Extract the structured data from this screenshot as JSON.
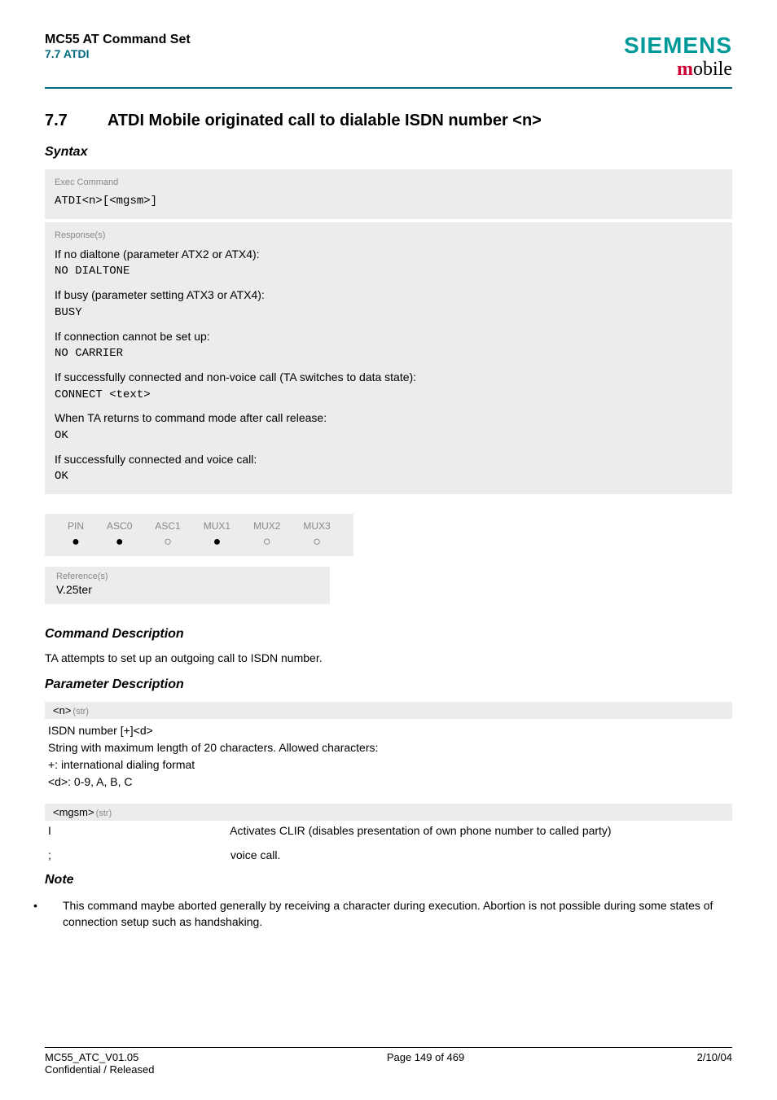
{
  "header": {
    "title": "MC55 AT Command Set",
    "subtitle": "7.7 ATDI",
    "logo_main": "SIEMENS",
    "logo_sub_m": "m",
    "logo_sub_rest": "obile"
  },
  "section": {
    "number": "7.7",
    "title": "ATDI   Mobile originated call to dialable ISDN number <n>"
  },
  "syntax": {
    "heading": "Syntax",
    "exec_label": "Exec Command",
    "exec_cmd_prefix": "ATDI",
    "exec_cmd_param": "<n>",
    "exec_cmd_open": "[",
    "exec_cmd_mgsm": "<mgsm>",
    "exec_cmd_close": "]",
    "resp_label": "Response(s)",
    "lines": [
      {
        "pre": "If no dialtone (parameter ATX2 or ATX4):",
        "code": "NO DIALTONE"
      },
      {
        "pre": "If busy (parameter setting ATX3 or ATX4):",
        "code": "BUSY"
      },
      {
        "pre": "If connection cannot be set up:",
        "code": "NO CARRIER"
      },
      {
        "pre": "If successfully connected and non-voice call (TA switches to data state):",
        "code": "CONNECT <text>"
      },
      {
        "pre": "When TA returns to command mode after call release:",
        "code": "OK"
      },
      {
        "pre": "If successfully connected and voice call:",
        "code": "OK"
      }
    ]
  },
  "indicators": {
    "cols": [
      "PIN",
      "ASC0",
      "ASC1",
      "MUX1",
      "MUX2",
      "MUX3"
    ],
    "vals": [
      "filled",
      "filled",
      "empty",
      "filled",
      "empty",
      "empty"
    ]
  },
  "reference": {
    "label": "Reference(s)",
    "text": "V.25ter"
  },
  "cmd_desc": {
    "heading": "Command Description",
    "text": "TA attempts to set up an outgoing call to ISDN number."
  },
  "param_desc": {
    "heading": "Parameter Description",
    "p1_name": "<n>",
    "p1_type": "(str)",
    "p1_lines": "ISDN number [+]<d>\nString with maximum length of 20 characters. Allowed characters:\n+: international dialing format\n<d>:  0-9, A, B, C",
    "p2_name": "<mgsm>",
    "p2_type": "(str)",
    "p2_line1": "I",
    "p2_desc1": "Activates CLIR (disables presentation of own phone number to called party)",
    "p2_line2": ";",
    "p2_desc2": "voice call."
  },
  "note": {
    "heading": "Note",
    "item": "This command maybe aborted generally by receiving a character during execution. Abortion is not possible during some states of connection setup such as handshaking."
  },
  "footer": {
    "left1": "MC55_ATC_V01.05",
    "left2": "Confidential / Released",
    "center": "Page 149 of 469",
    "right": "2/10/04"
  }
}
